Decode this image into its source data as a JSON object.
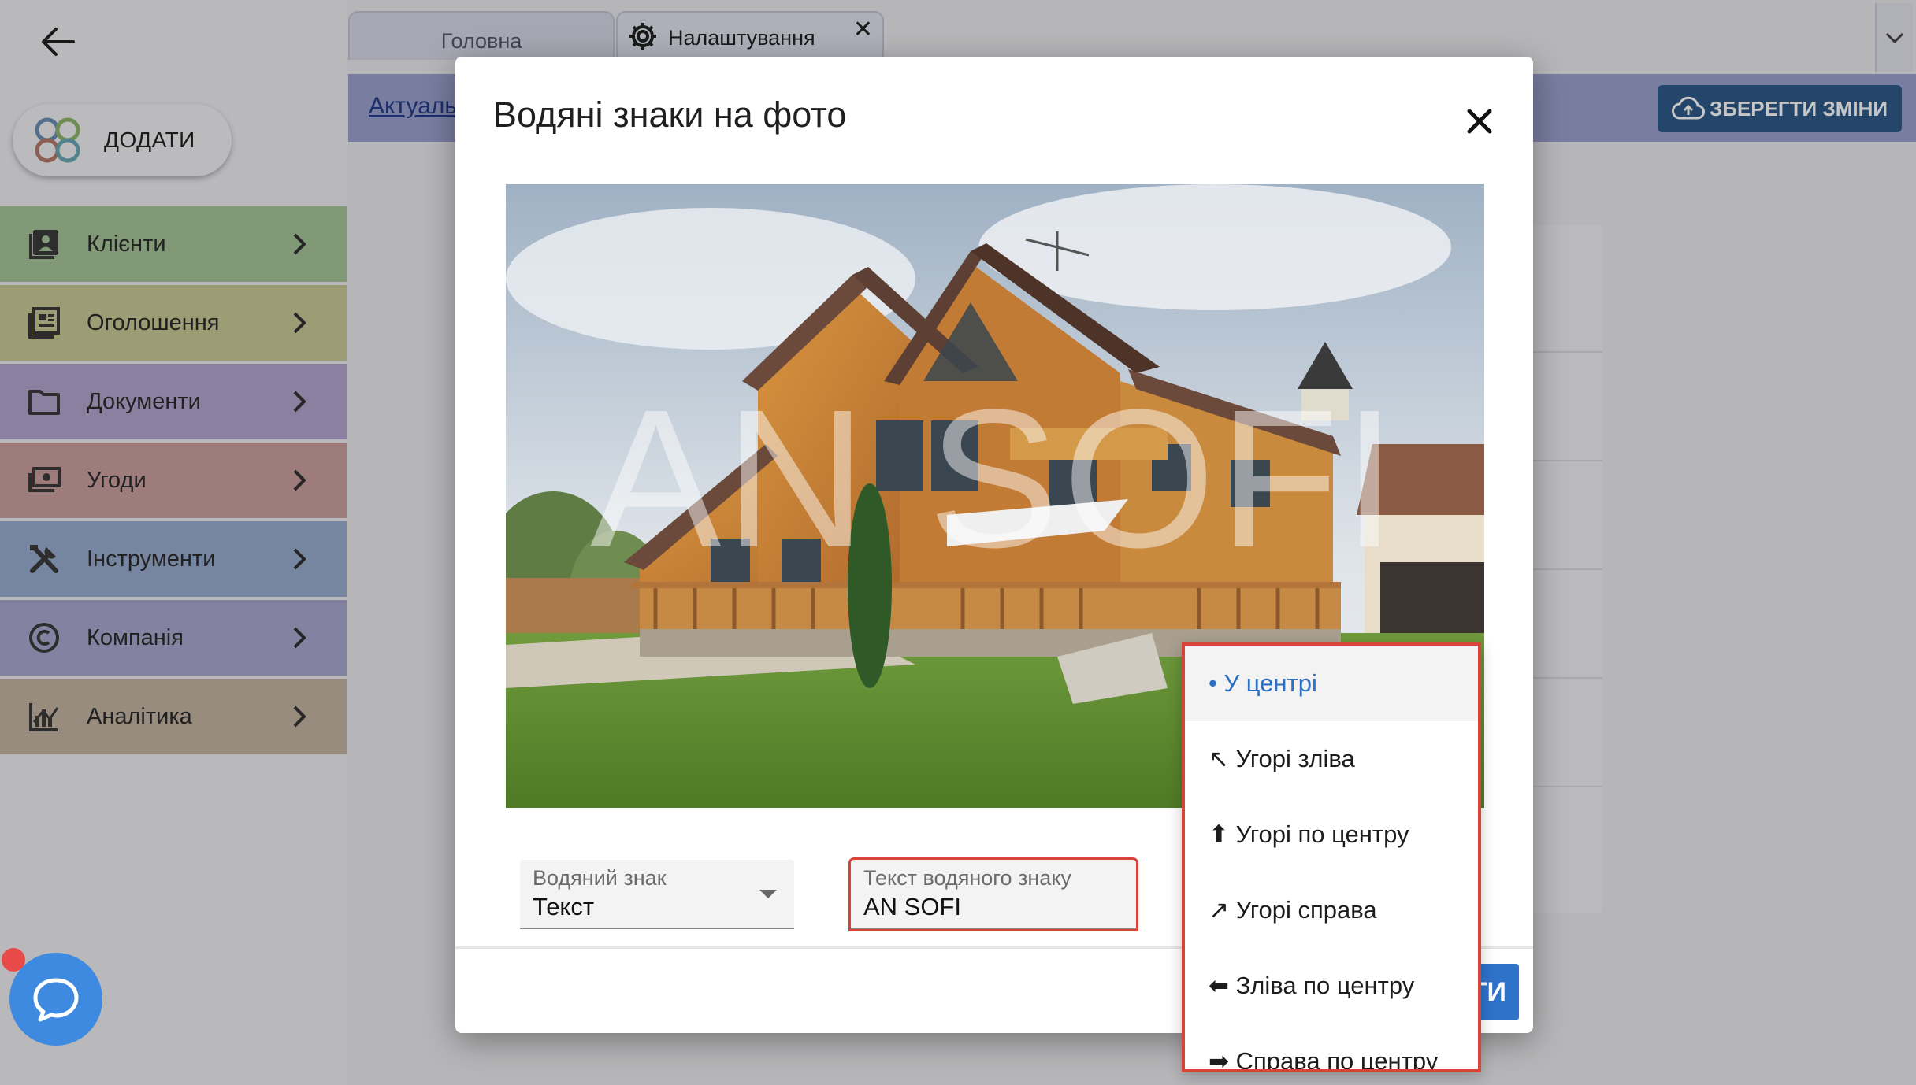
{
  "sidebar": {
    "add_label": "ДОДАТИ",
    "items": [
      {
        "label": "Клієнти",
        "icon": "contacts-icon",
        "color": "#a7c59a"
      },
      {
        "label": "Оголошення",
        "icon": "listings-icon",
        "color": "#c9c997"
      },
      {
        "label": "Документи",
        "icon": "folder-icon",
        "color": "#b4a5cf"
      },
      {
        "label": "Угоди",
        "icon": "money-icon",
        "color": "#cc9f9f"
      },
      {
        "label": "Інструменти",
        "icon": "tools-icon",
        "color": "#98abcd"
      },
      {
        "label": "Компанія",
        "icon": "copyright-icon",
        "color": "#a8a8cf"
      },
      {
        "label": "Аналітика",
        "icon": "analytics-icon",
        "color": "#c3b4a2"
      }
    ]
  },
  "tabs": {
    "main": "Головна",
    "settings": "Налаштування",
    "close": "✕"
  },
  "subbar": {
    "link": "Актуаль",
    "save_label": "ЗБЕРЕГТИ ЗМІНИ"
  },
  "modal": {
    "title": "Водяні знаки на фото",
    "watermark_text": "AN SOFI",
    "type_field": {
      "label": "Водяний знак",
      "value": "Текст"
    },
    "text_field": {
      "label": "Текст водяного знаку",
      "value": "AN SOFI"
    },
    "confirm_partial": "ТИ"
  },
  "position_menu": {
    "selected_index": 0,
    "items": [
      "• У центрі",
      "↖ Угорі зліва",
      "⬆ Угорі по центру",
      "↗ Угорі справа",
      "⬅ Зліва по центру",
      "➡ Справа по центру"
    ]
  },
  "colors": {
    "accent": "#2e72c9",
    "highlight_border": "#d9443a",
    "save_button": "#2f5a8a",
    "subbar": "#9ca0cc"
  }
}
